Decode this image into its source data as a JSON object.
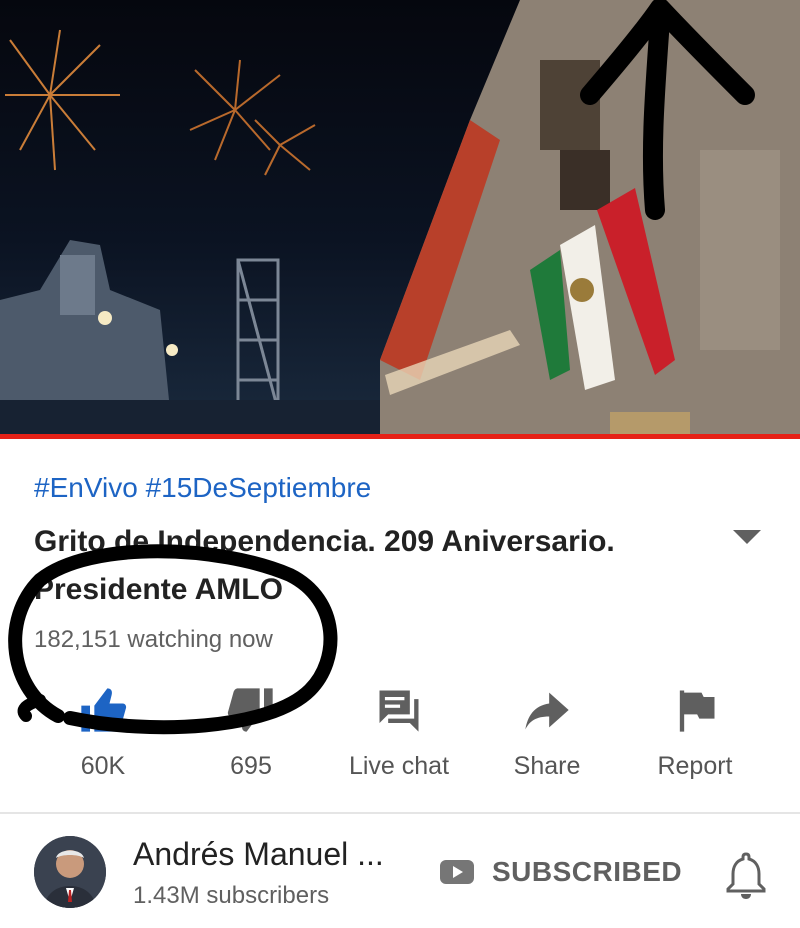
{
  "video": {
    "progress_percent": 100,
    "accent_color": "#e62117"
  },
  "metadata": {
    "hashtags": "#EnVivo #15DeSeptiembre",
    "title": "Grito de Independencia. 209 Aniversario. Presidente AMLO",
    "views": "182,151 watching now",
    "link_color": "#1d64c4"
  },
  "actions": [
    {
      "icon": "thumbs-up-icon",
      "label": "60K"
    },
    {
      "icon": "thumbs-down-icon",
      "label": "695"
    },
    {
      "icon": "live-chat-icon",
      "label": "Live chat"
    },
    {
      "icon": "share-icon",
      "label": "Share"
    },
    {
      "icon": "flag-icon",
      "label": "Report"
    }
  ],
  "channel": {
    "name": "Andrés Manuel ...",
    "subscribers": "1.43M subscribers",
    "subscribe_label": "SUBSCRIBED"
  }
}
